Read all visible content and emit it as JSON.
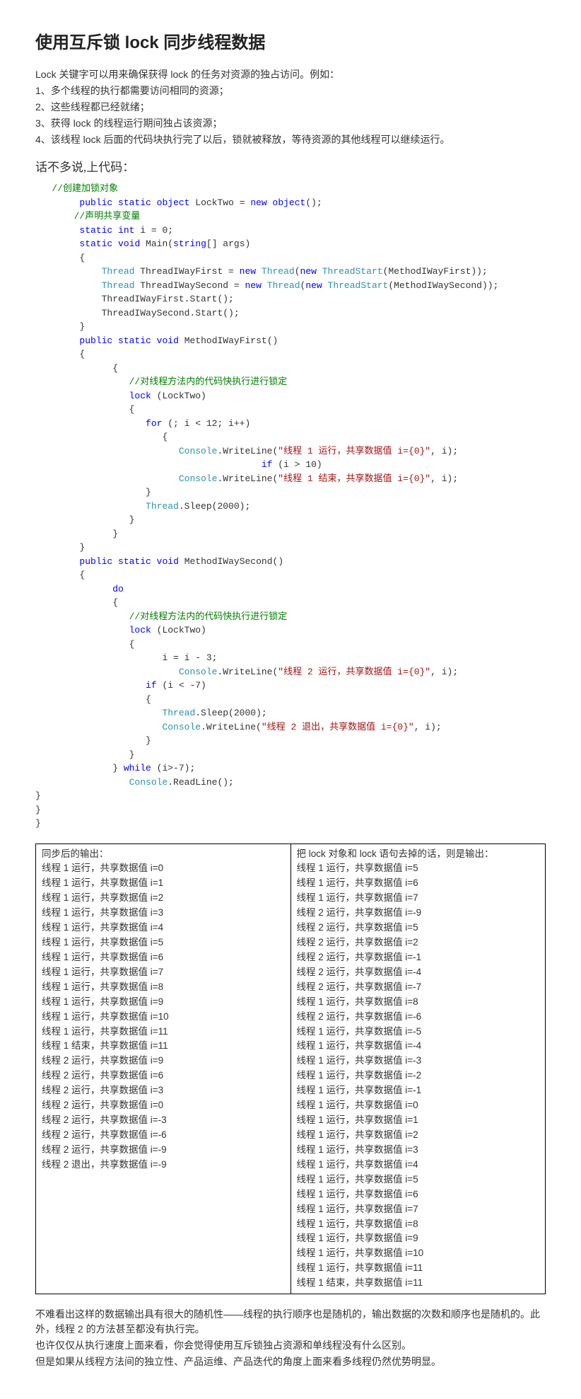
{
  "title": "使用互斥锁 lock 同步线程数据",
  "intro": {
    "p0": "Lock 关键字可以用来确保获得 lock 的任务对资源的独占访问。例如：",
    "p1": "1、多个线程的执行都需要访问相同的资源；",
    "p2": "2、这些线程都已经就绪；",
    "p3": "3、获得 lock 的线程运行期间独占该资源；",
    "p4": "4、该线程 lock 后面的代码块执行完了以后，锁就被释放，等待资源的其他线程可以继续运行。"
  },
  "subhead": "话不多说,上代码：",
  "code": {
    "c01a": "//创建加锁对象",
    "c02a": "public",
    "c02b": "static",
    "c02c": "object",
    "c02d": " LockTwo = ",
    "c02e": "new",
    "c02f": "object",
    "c02g": "();",
    "c03a": "//声明共享变量",
    "c04a": "static",
    "c04b": "int",
    "c04c": " i = 0;",
    "c05a": "static",
    "c05b": "void",
    "c05c": " Main(",
    "c05d": "string",
    "c05e": "[] args)",
    "c06a": "{",
    "c07a": "Thread",
    "c07b": " ThreadIWayFirst = ",
    "c07c": "new",
    "c07d": "Thread",
    "c07e": "(",
    "c07f": "new",
    "c07g": "ThreadStart",
    "c07h": "(MethodIWayFirst));",
    "c08a": "Thread",
    "c08b": " ThreadIWaySecond = ",
    "c08c": "new",
    "c08d": "Thread",
    "c08e": "(",
    "c08f": "new",
    "c08g": "ThreadStart",
    "c08h": "(MethodIWaySecond));",
    "c09a": "ThreadIWayFirst.Start();",
    "c10a": "ThreadIWaySecond.Start();",
    "c11a": "}",
    "c12a": "public",
    "c12b": "static",
    "c12c": "void",
    "c12d": " MethodIWayFirst()",
    "c13a": "{",
    "c14a": "{",
    "c15a": "//对线程方法内的代码快执行进行锁定",
    "c16a": "lock",
    "c16b": " (LockTwo)",
    "c17a": "{",
    "c18a": "for",
    "c18b": " (; i < 12; i++)",
    "c19a": "{",
    "c20a": "Console",
    "c20b": ".WriteLine(",
    "c20c": "\"线程 1 运行，共享数据值 i={0}\"",
    "c20d": ", i);",
    "c21a": "if",
    "c21b": " (i > 10)",
    "c22a": "Console",
    "c22b": ".WriteLine(",
    "c22c": "\"线程 1 结束，共享数据值 i={0}\"",
    "c22d": ", i);",
    "c23a": "}",
    "c24a": "Thread",
    "c24b": ".Sleep(2000);",
    "c25a": "}",
    "c26a": "}",
    "c27a": "}",
    "c28a": "public",
    "c28b": "static",
    "c28c": "void",
    "c28d": " MethodIWaySecond()",
    "c29a": "{",
    "c30a": "do",
    "c31a": "{",
    "c32a": "//对线程方法内的代码快执行进行锁定",
    "c33a": "lock",
    "c33b": " (LockTwo)",
    "c34a": "{",
    "c35a": "i = i - 3;",
    "c36a": "Console",
    "c36b": ".WriteLine(",
    "c36c": "\"线程 2 运行，共享数据值 i={0}\"",
    "c36d": ", i);",
    "c37a": "if",
    "c37b": " (i < -7)",
    "c38a": "{",
    "c39a": "Thread",
    "c39b": ".Sleep(2000);",
    "c40a": "Console",
    "c40b": ".WriteLine(",
    "c40c": "\"线程 2 退出，共享数据值 i={0}\"",
    "c40d": ", i);",
    "c41a": "}",
    "c42a": "}",
    "c43a": "} ",
    "c43b": "while",
    "c43c": " (i>-7);",
    "c44a": "Console",
    "c44b": ".ReadLine();",
    "c45a": "}",
    "c46a": "}",
    "c47a": "}"
  },
  "table": {
    "left_header": "同步后的输出：",
    "right_header": "把 lock 对象和 lock 语句去掉的话，则是输出：",
    "left": [
      "线程 1 运行，共享数据值 i=0",
      "线程 1 运行，共享数据值 i=1",
      "线程 1 运行，共享数据值 i=2",
      "线程 1 运行，共享数据值 i=3",
      "线程 1 运行，共享数据值 i=4",
      "线程 1 运行，共享数据值 i=5",
      "线程 1 运行，共享数据值 i=6",
      "线程 1 运行，共享数据值 i=7",
      "线程 1 运行，共享数据值 i=8",
      "线程 1 运行，共享数据值 i=9",
      "线程 1 运行，共享数据值 i=10",
      "线程 1 运行，共享数据值 i=11",
      "线程 1 结束，共享数据值 i=11",
      "线程 2 运行，共享数据值 i=9",
      "线程 2 运行，共享数据值 i=6",
      "线程 2 运行，共享数据值 i=3",
      "线程 2 运行，共享数据值 i=0",
      "线程 2 运行，共享数据值 i=-3",
      "线程 2 运行，共享数据值 i=-6",
      "线程 2 运行，共享数据值 i=-9",
      "线程 2 退出，共享数据值 i=-9"
    ],
    "right": [
      "线程 1 运行，共享数据值 i=5",
      "线程 1 运行，共享数据值 i=6",
      "线程 1 运行，共享数据值 i=7",
      "线程 2 运行，共享数据值 i=-9",
      "线程 2 运行，共享数据值 i=5",
      "线程 2 运行，共享数据值 i=2",
      "线程 2 运行，共享数据值 i=-1",
      "线程 2 运行，共享数据值 i=-4",
      "线程 2 运行，共享数据值 i=-7",
      "线程 1 运行，共享数据值 i=8",
      "线程 2 运行，共享数据值 i=-6",
      "线程 1 运行，共享数据值 i=-5",
      "线程 1 运行，共享数据值 i=-4",
      "线程 1 运行，共享数据值 i=-3",
      "线程 1 运行，共享数据值 i=-2",
      "线程 1 运行，共享数据值 i=-1",
      "线程 1 运行，共享数据值 i=0",
      "线程 1 运行，共享数据值 i=1",
      "线程 1 运行，共享数据值 i=2",
      "线程 1 运行，共享数据值 i=3",
      "线程 1 运行，共享数据值 i=4",
      "线程 1 运行，共享数据值 i=5",
      "线程 1 运行，共享数据值 i=6",
      "线程 1 运行，共享数据值 i=7",
      "线程 1 运行，共享数据值 i=8",
      "线程 1 运行，共享数据值 i=9",
      "线程 1 运行，共享数据值 i=10",
      "线程 1 运行，共享数据值 i=11",
      "线程 1 结束，共享数据值 i=11"
    ]
  },
  "outro": {
    "p0": "不难看出这样的数据输出具有很大的随机性——线程的执行顺序也是随机的，输出数据的次数和顺序也是随机的。此外，线程 2 的方法甚至都没有执行完。",
    "p1": "也许仅仅从执行速度上面来看，你会觉得使用互斥锁独占资源和单线程没有什么区别。",
    "p2": "但是如果从线程方法间的独立性、产品运维、产品迭代的角度上面来看多线程仍然优势明显。"
  }
}
